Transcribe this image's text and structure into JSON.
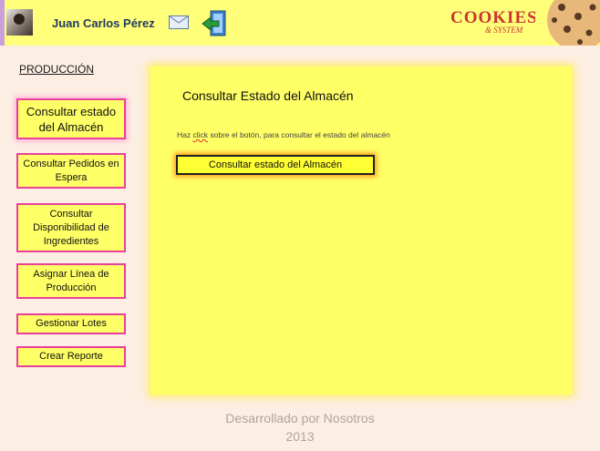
{
  "header": {
    "user_name": "Juan Carlos Pérez",
    "logo_text": "COOKIES",
    "logo_subtext": "& SYSTEM"
  },
  "sidebar": {
    "title": "PRODUCCIÓN",
    "items": [
      {
        "label": "Consultar estado del Almacén"
      },
      {
        "label": "Consultar Pedidos en Espera"
      },
      {
        "label": "Consultar Disponibilidad de Ingredientes"
      },
      {
        "label": "Asignar Línea de Producción"
      },
      {
        "label": "Gestionar Lotes"
      },
      {
        "label": "Crear Reporte"
      }
    ]
  },
  "main": {
    "title": "Consultar Estado del Almacén",
    "instruction_pre": "Haz ",
    "instruction_word": "click",
    "instruction_post": " sobre el botón, para consultar el estado del almacén",
    "button_label": "Consultar estado del Almacén"
  },
  "footer": {
    "line1": "Desarrollado por Nosotros",
    "line2": "2013"
  },
  "colors": {
    "header_bg": "#ffff7a",
    "panel_bg": "#ffff66",
    "button_border": "#e8409b",
    "page_bg": "#fdeee3"
  }
}
